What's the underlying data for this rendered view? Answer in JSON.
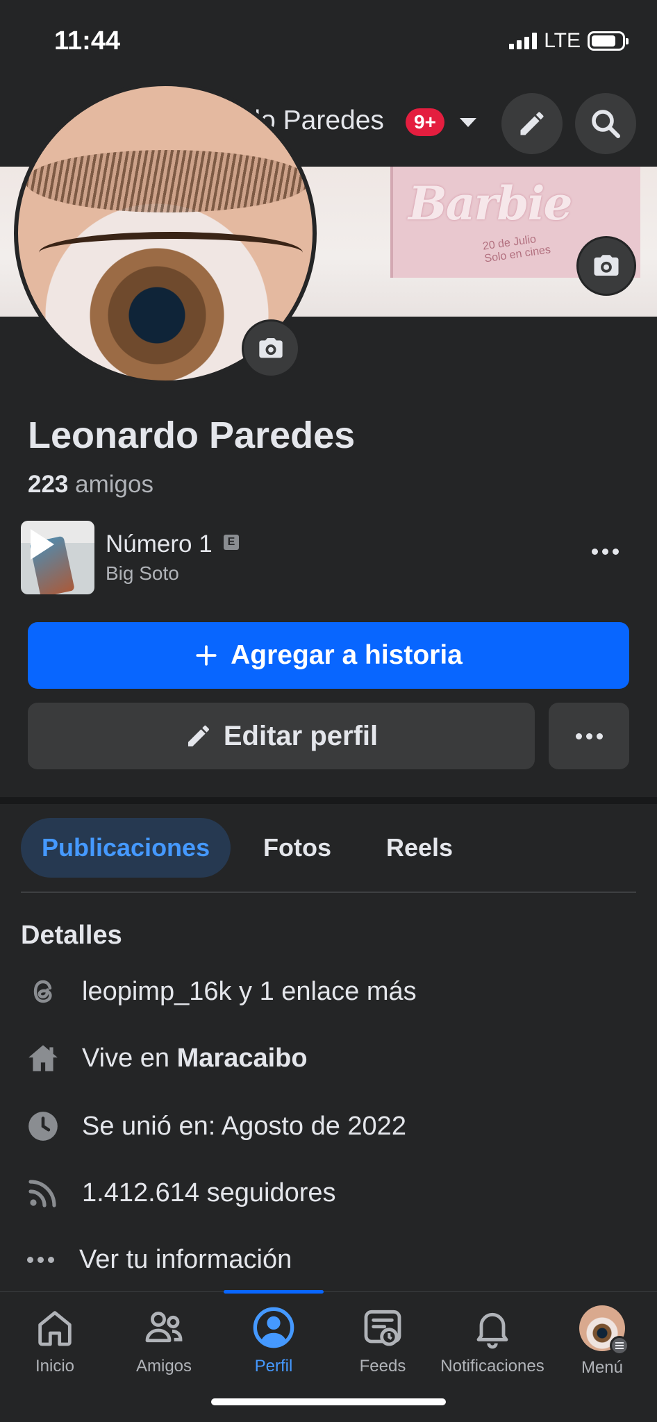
{
  "status": {
    "time": "11:44",
    "network": "LTE"
  },
  "header": {
    "name": "Leonardo Paredes",
    "badge": "9+"
  },
  "cover": {
    "poster_title": "Barbie",
    "poster_line1": "20 de Julio",
    "poster_line2": "Solo en cines"
  },
  "profile": {
    "name": "Leonardo Paredes",
    "friends_count": "223",
    "friends_label": "amigos"
  },
  "song": {
    "title": "Número 1",
    "explicit": "E",
    "artist": "Big Soto"
  },
  "buttons": {
    "add_story": "Agregar a historia",
    "edit_profile": "Editar perfil"
  },
  "tabs": [
    {
      "label": "Publicaciones",
      "active": true
    },
    {
      "label": "Fotos",
      "active": false
    },
    {
      "label": "Reels",
      "active": false
    }
  ],
  "details": {
    "title": "Detalles",
    "threads": "leopimp_16k y 1 enlace más",
    "lives_prefix": "Vive en ",
    "lives_city": "Maracaibo",
    "joined": "Se unió en: Agosto de 2022",
    "followers": "1.412.614 seguidores",
    "more": "Ver tu información"
  },
  "nav": [
    {
      "label": "Inicio",
      "icon": "home-icon"
    },
    {
      "label": "Amigos",
      "icon": "friends-icon"
    },
    {
      "label": "Perfil",
      "icon": "profile-icon",
      "active": true
    },
    {
      "label": "Feeds",
      "icon": "feeds-icon"
    },
    {
      "label": "Notificaciones",
      "icon": "bell-icon"
    },
    {
      "label": "Menú",
      "icon": "menu-avatar"
    }
  ],
  "colors": {
    "accent": "#0866ff",
    "background": "#242526",
    "badge": "#e41e3f",
    "active_tab_text": "#4599ff"
  }
}
